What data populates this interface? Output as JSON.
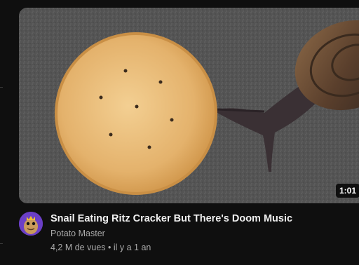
{
  "video": {
    "title": "Snail Eating Ritz Cracker But There's Doom Music",
    "channel": "Potato Master",
    "views": "4,2 M de vues",
    "separator": "•",
    "age": "il y a 1 an",
    "duration": "1:01"
  },
  "thumbnail": {
    "subject": "snail-and-cracker",
    "colors": {
      "background": "#5e5e5e",
      "cracker": "#e3b06a",
      "snail_body": "#3a3034",
      "shell": "#6e5036"
    }
  },
  "avatar": {
    "icon": "potato-mascot-icon",
    "color": "#6b3fc6"
  }
}
